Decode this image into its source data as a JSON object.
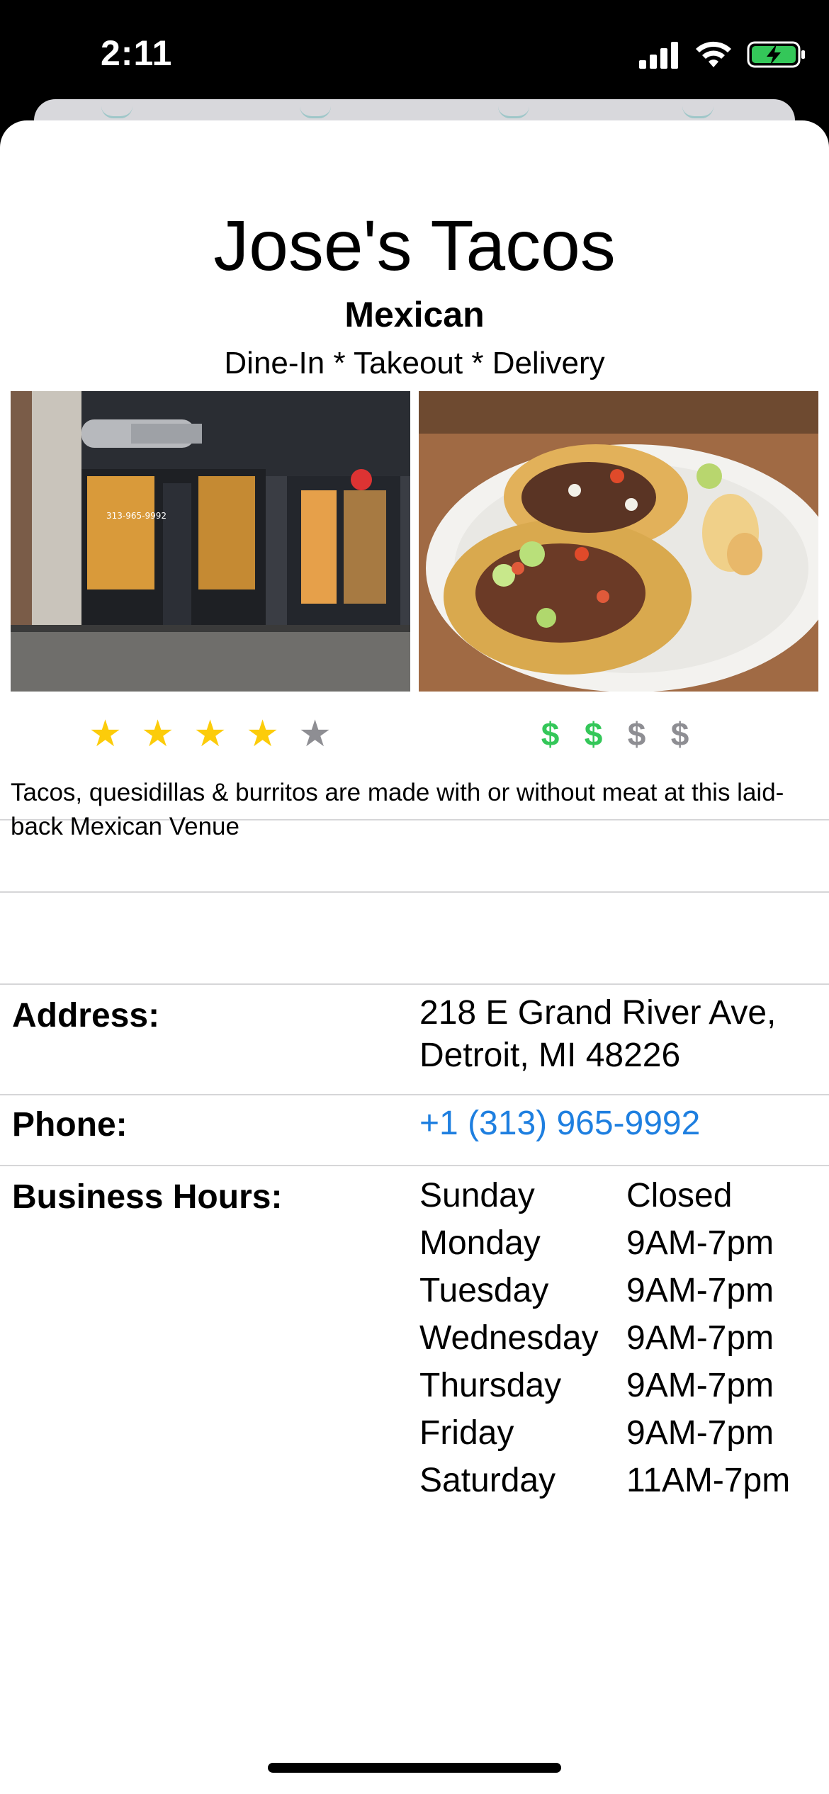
{
  "status_bar": {
    "time": "2:11",
    "icons": [
      "signal-icon",
      "wifi-icon",
      "battery-charging-icon"
    ]
  },
  "restaurant": {
    "name": "Jose's Tacos",
    "cuisine": "Mexican",
    "services": "Dine-In * Takeout * Delivery",
    "rating": 4,
    "rating_max": 5,
    "price_level": 2,
    "price_max": 4,
    "price_symbol": "$",
    "star_symbol": "★",
    "description": "Tacos, quesidillas & burritos are made with or without meat at this laid-back Mexican Venue"
  },
  "details": {
    "address_label": "Address:",
    "address_line1": "218 E Grand River Ave,",
    "address_line2": "Detroit, MI 48226",
    "phone_label": "Phone:",
    "phone": "+1 (313) 965-9992",
    "hours_label": "Business Hours:",
    "hours": [
      {
        "day": "Sunday",
        "time": "Closed"
      },
      {
        "day": "Monday",
        "time": "9AM-7pm"
      },
      {
        "day": "Tuesday",
        "time": "9AM-7pm"
      },
      {
        "day": "Wednesday",
        "time": "9AM-7pm"
      },
      {
        "day": "Thursday",
        "time": "9AM-7pm"
      },
      {
        "day": "Friday",
        "time": "9AM-7pm"
      },
      {
        "day": "Saturday",
        "time": "11AM-7pm"
      }
    ]
  },
  "photos": {
    "left_sign_text": "313-965-9992"
  },
  "colors": {
    "star_active": "#fccc0a",
    "star_inactive": "#8e8e93",
    "price_active": "#34c759",
    "price_inactive": "#8e8e93",
    "link": "#1e7fe0"
  }
}
